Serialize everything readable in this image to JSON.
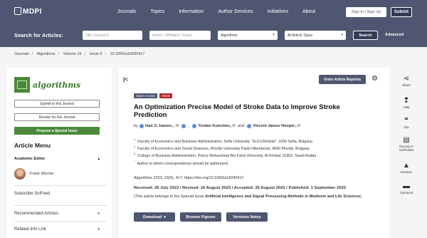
{
  "brand": {
    "logo": "MDPI"
  },
  "nav": {
    "items": [
      "Journals",
      "Topics",
      "Information",
      "Author Services",
      "Initiatives",
      "About"
    ],
    "signin": "Sign In / Sign Up",
    "submit": "Submit"
  },
  "search": {
    "label": "Search for Articles:",
    "title_placeholder": "Title / Keyword",
    "author_placeholder": "Author / Affiliation / Email",
    "journal_value": "Algorithms",
    "type_value": "All Article Types",
    "search_button": "Search",
    "advanced": "Advanced"
  },
  "breadcrumb": [
    "Journals",
    "Algorithms",
    "Volume 16",
    "Issue 9",
    "10.3390/a16090417"
  ],
  "sidebar": {
    "journal_name": "algorithms",
    "submit_btn": "Submit to this Journal",
    "review_btn": "Review for this Journal",
    "propose_btn": "Propose a Special Issue",
    "menu_title": "Article Menu",
    "academic_editor_label": "Academic Editor",
    "editor_name": "Frank Werner",
    "links": [
      "Subscribe SciFeed",
      "Recommended Articles",
      "Related Info Link"
    ]
  },
  "article": {
    "reprints": "Order Article Reprints",
    "badges": [
      {
        "text": "Open Access",
        "color": "#4f5671"
      },
      {
        "text": "Article",
        "color": "#b0262e"
      }
    ],
    "title": "An Optimization Precise Model of Stroke Data to Improve Stroke Prediction",
    "by": "by",
    "authors": [
      {
        "name": "Ivan G. Ivanov",
        "sup": "1,*"
      },
      {
        "name": "Yordan Kumchev",
        "sup": "2"
      },
      {
        "name": "Vincent James Hooper",
        "sup": "3"
      }
    ],
    "and": "and",
    "affiliations": [
      {
        "sup": "1",
        "text": "Faculty of Economics and Business Administration, Sofia University “St.Kl.Ohridski”, 1000 Sofia, Bulgaria"
      },
      {
        "sup": "2",
        "text": "Faculty of Economics and Social Sciences, Plovdiv University Paisii Hilendarski, 4000 Plovdiv, Bulgaria"
      },
      {
        "sup": "3",
        "text": "College of Business Administration, Prince Mohammad Bin Fahd University, Al Khobar 31952, Saudi Arabia"
      },
      {
        "sup": "*",
        "text": "Author to whom correspondence should be addressed."
      }
    ],
    "citation_journal": "Algorithms",
    "citation_rest": "2023, 16(9), 417; https://doi.org/10.3390/a16090417",
    "dates": "Received: 26 July 2023 / Revised: 16 August 2023 / Accepted: 25 August 2023 / Published: 1 September 2023",
    "special_prefix": "(This article belongs to the Special Issue ",
    "special_title": "Artificial Intelligence and Signal Processing Methods in Medicine and Life Sciences",
    "special_suffix": ")",
    "actions": [
      "Download",
      "Browse Figures",
      "Versions Notes"
    ]
  },
  "rightbar": [
    {
      "icon": "share-icon",
      "label": "Share"
    },
    {
      "icon": "help-icon",
      "label": "Help"
    },
    {
      "icon": "cite-icon",
      "label": "Cite"
    },
    {
      "icon": "discuss-icon",
      "label": "Discuss in SciProfiles"
    },
    {
      "icon": "endorse-icon",
      "label": "Endorse"
    },
    {
      "icon": "comment-icon",
      "label": "Comment"
    }
  ]
}
